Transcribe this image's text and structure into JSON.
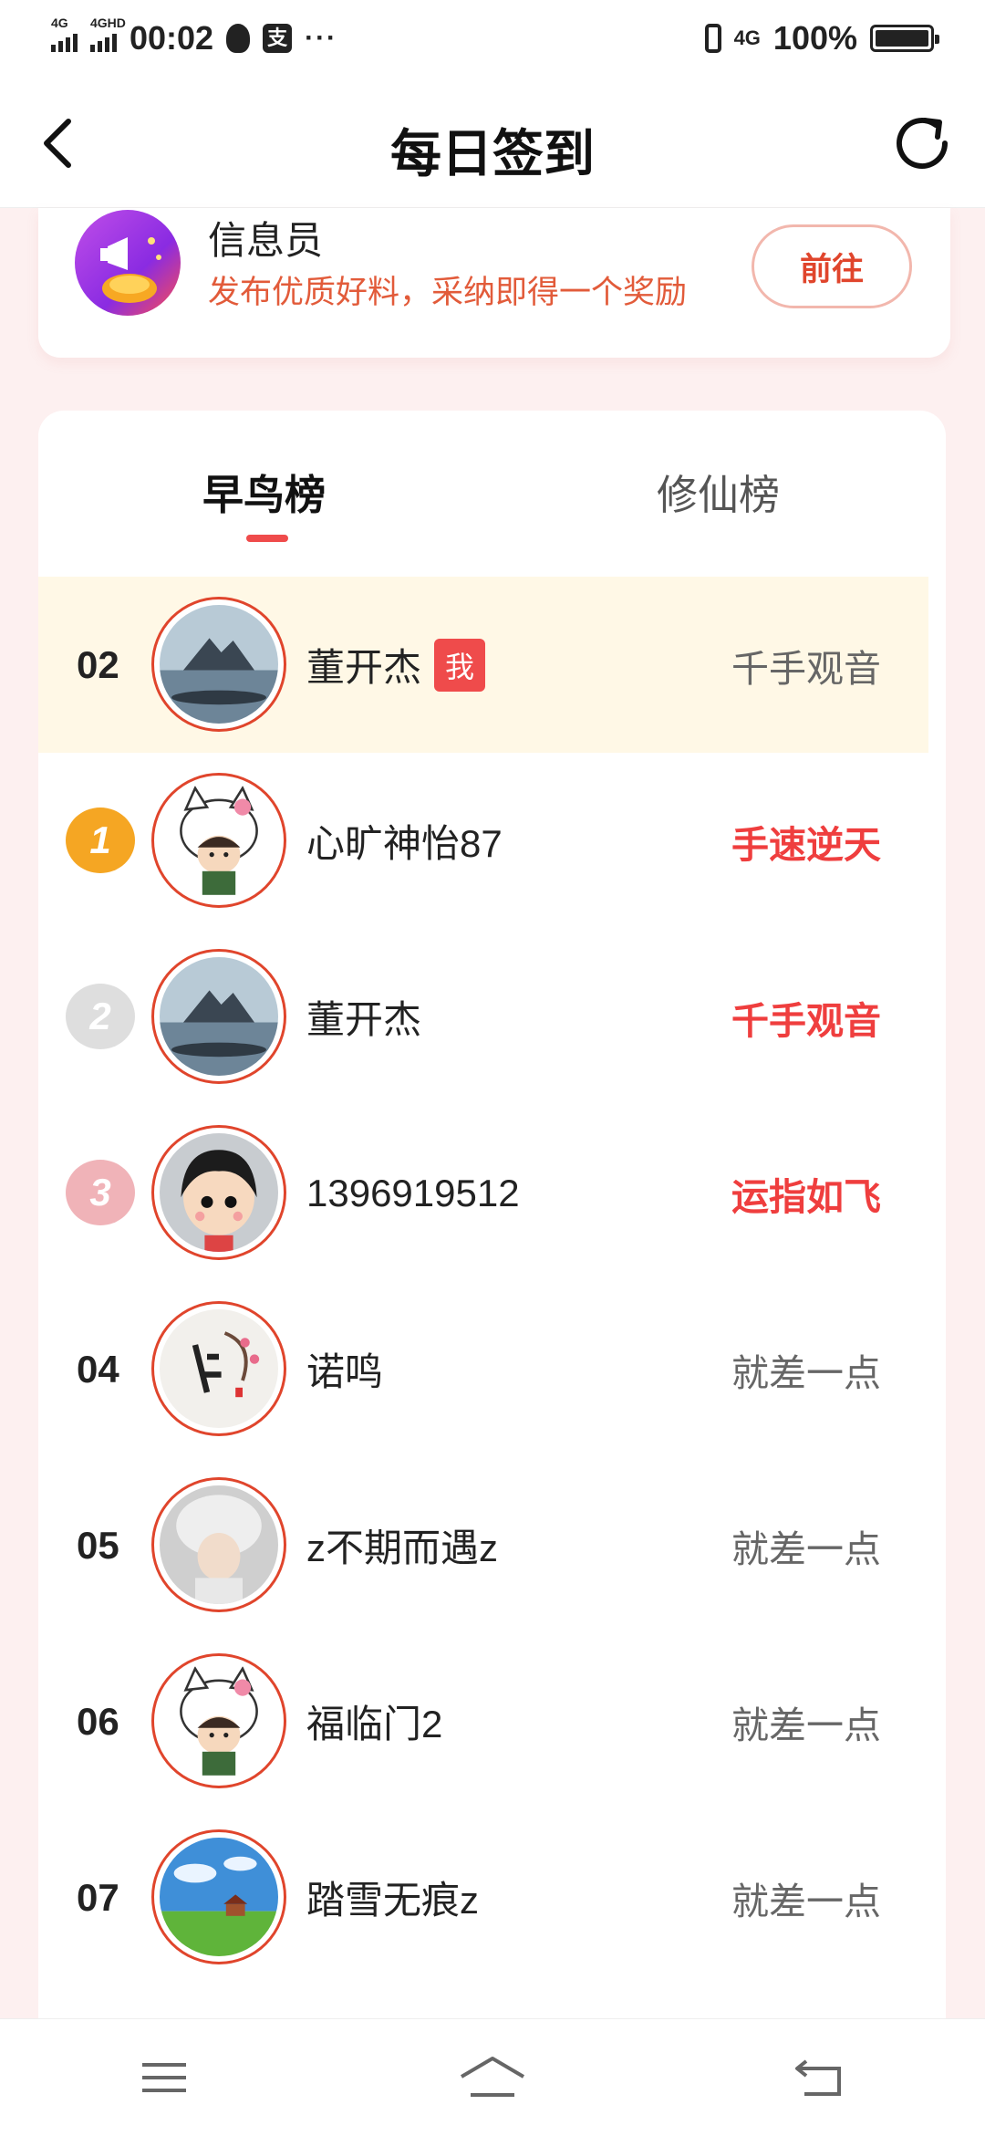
{
  "status_bar": {
    "signal1": "4G",
    "signal2": "4GHD",
    "time": "00:02",
    "zhi_icon": "支",
    "dots": "···",
    "signal3": "4G",
    "battery": "100%"
  },
  "header": {
    "title": "每日签到",
    "back_icon": "chevron-left-icon",
    "refresh_icon": "refresh-icon"
  },
  "info_card": {
    "title": "信息员",
    "desc": "发布优质好料，采纳即得一个奖励",
    "button": "前往"
  },
  "tabs": [
    {
      "label": "早鸟榜",
      "active": true
    },
    {
      "label": "修仙榜",
      "active": false
    }
  ],
  "rows": [
    {
      "rank": "02",
      "name": "董开杰",
      "badge": "我",
      "title": "千手观音",
      "avatar": "mountain-lake"
    },
    {
      "rank": "1",
      "name": "心旷神怡87",
      "title": "手速逆天",
      "avatar": "hello-kitty-girl"
    },
    {
      "rank": "2",
      "name": "董开杰",
      "title": "千手观音",
      "avatar": "mountain-lake"
    },
    {
      "rank": "3",
      "name": "1396919512",
      "title": "运指如飞",
      "avatar": "cartoon-girl"
    },
    {
      "rank": "04",
      "name": "诺鸣",
      "title": "就差一点",
      "avatar": "calligraphy"
    },
    {
      "rank": "05",
      "name": "z不期而遇z",
      "title": "就差一点",
      "avatar": "furry-hat-girl"
    },
    {
      "rank": "06",
      "name": "福临门2",
      "title": "就差一点",
      "avatar": "hello-kitty-girl"
    },
    {
      "rank": "07",
      "name": "踏雪无痕z",
      "title": "就差一点",
      "avatar": "meadow-house"
    }
  ],
  "colors": {
    "accent": "#ef4b4b",
    "highlight_row": "#fff8e6",
    "gold": "#f5a623",
    "silver": "#dedede",
    "bronze": "#f0b3b8"
  },
  "navbar": [
    "menu-icon",
    "home-icon",
    "back-icon"
  ]
}
